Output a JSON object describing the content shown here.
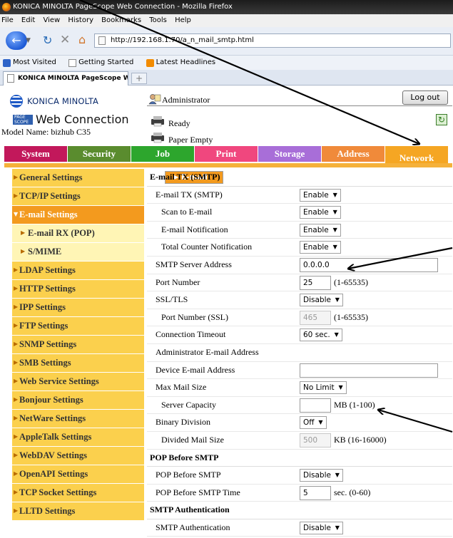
{
  "browser": {
    "window_title": "KONICA MINOLTA PageScope Web Connection - Mozilla Firefox",
    "menu": [
      "File",
      "Edit",
      "View",
      "History",
      "Bookmarks",
      "Tools",
      "Help"
    ],
    "url": "http://192.168.1.70/a_n_mail_smtp.html",
    "bookmarks": [
      "Most Visited",
      "Getting Started",
      "Latest Headlines"
    ],
    "tab_title": "KONICA MINOLTA PageScope Web C...",
    "new_tab": "+",
    "icons": {
      "back": "back-arrow-icon",
      "reload": "reload-icon",
      "stop": "stop-icon",
      "home": "home-icon"
    }
  },
  "header": {
    "brand": "KONICA MINOLTA",
    "product_badge": "PAGE SCOPE",
    "product": "Web Connection",
    "model_label": "Model Name:",
    "model_value": "bizhub C35",
    "user": "Administrator",
    "logout": "Log out",
    "status_ready": "Ready",
    "status_paper": "Paper Empty"
  },
  "main_tabs": [
    {
      "label": "System",
      "color": "#c2185b"
    },
    {
      "label": "Security",
      "color": "#5a8c2e"
    },
    {
      "label": "Job",
      "color": "#2da62d"
    },
    {
      "label": "Print",
      "color": "#f0477e"
    },
    {
      "label": "Storage",
      "color": "#a86ed8"
    },
    {
      "label": "Address",
      "color": "#f08a3a"
    },
    {
      "label": "Network",
      "color": "#f5a623",
      "active": true
    }
  ],
  "menu": [
    {
      "label": "General Settings",
      "level": 1
    },
    {
      "label": "TCP/IP Settings",
      "level": 1
    },
    {
      "label": "E-mail Settings",
      "level": 1,
      "open": true
    },
    {
      "label": "E-mail TX (SMTP)",
      "level": 2,
      "selected": true
    },
    {
      "label": "E-mail RX (POP)",
      "level": 2
    },
    {
      "label": "S/MIME",
      "level": 2
    },
    {
      "label": "LDAP Settings",
      "level": 1
    },
    {
      "label": "HTTP Settings",
      "level": 1
    },
    {
      "label": "IPP Settings",
      "level": 1
    },
    {
      "label": "FTP Settings",
      "level": 1
    },
    {
      "label": "SNMP Settings",
      "level": 1
    },
    {
      "label": "SMB Settings",
      "level": 1
    },
    {
      "label": "Web Service Settings",
      "level": 1
    },
    {
      "label": "Bonjour Settings",
      "level": 1
    },
    {
      "label": "NetWare Settings",
      "level": 1
    },
    {
      "label": "AppleTalk Settings",
      "level": 1
    },
    {
      "label": "WebDAV Settings",
      "level": 1
    },
    {
      "label": "OpenAPI Settings",
      "level": 1
    },
    {
      "label": "TCP Socket Settings",
      "level": 1
    },
    {
      "label": "LLTD Settings",
      "level": 1
    }
  ],
  "form": {
    "section_title": "E-mail TX (SMTP)",
    "rows": [
      {
        "label": "E-mail TX (SMTP)",
        "type": "select",
        "value": "Enable"
      },
      {
        "label": "Scan to E-mail",
        "type": "select",
        "value": "Enable",
        "indent": true
      },
      {
        "label": "E-mail Notification",
        "type": "select",
        "value": "Enable",
        "indent": true
      },
      {
        "label": "Total Counter Notification",
        "type": "select",
        "value": "Enable",
        "indent": true
      },
      {
        "label": "SMTP Server Address",
        "type": "text",
        "value": "0.0.0.0",
        "width": "wide"
      },
      {
        "label": "Port Number",
        "type": "text",
        "value": "25",
        "hint": "(1-65535)"
      },
      {
        "label": "SSL/TLS",
        "type": "select",
        "value": "Disable"
      },
      {
        "label": "Port Number (SSL)",
        "type": "text",
        "value": "465",
        "hint": "(1-65535)",
        "indent": true,
        "disabled": true
      },
      {
        "label": "Connection Timeout",
        "type": "select",
        "value": "60 sec."
      },
      {
        "label": "Administrator E-mail Address",
        "type": "none"
      },
      {
        "label": "Device E-mail Address",
        "type": "text",
        "value": "",
        "width": "wide"
      },
      {
        "label": "Max Mail Size",
        "type": "select",
        "value": "No Limit"
      },
      {
        "label": "Server Capacity",
        "type": "text",
        "value": "",
        "hint": "MB (1-100)",
        "indent": true
      },
      {
        "label": "Binary Division",
        "type": "select",
        "value": "Off"
      },
      {
        "label": "Divided Mail Size",
        "type": "text",
        "value": "500",
        "hint": "KB (16-16000)",
        "indent": true,
        "disabled": true
      },
      {
        "label": "POP Before SMTP",
        "type": "section"
      },
      {
        "label": "POP Before SMTP",
        "type": "select",
        "value": "Disable"
      },
      {
        "label": "POP Before SMTP Time",
        "type": "text",
        "value": "5",
        "hint": "sec. (0-60)"
      },
      {
        "label": "SMTP Authentication",
        "type": "section"
      },
      {
        "label": "SMTP Authentication",
        "type": "select",
        "value": "Disable"
      }
    ]
  }
}
